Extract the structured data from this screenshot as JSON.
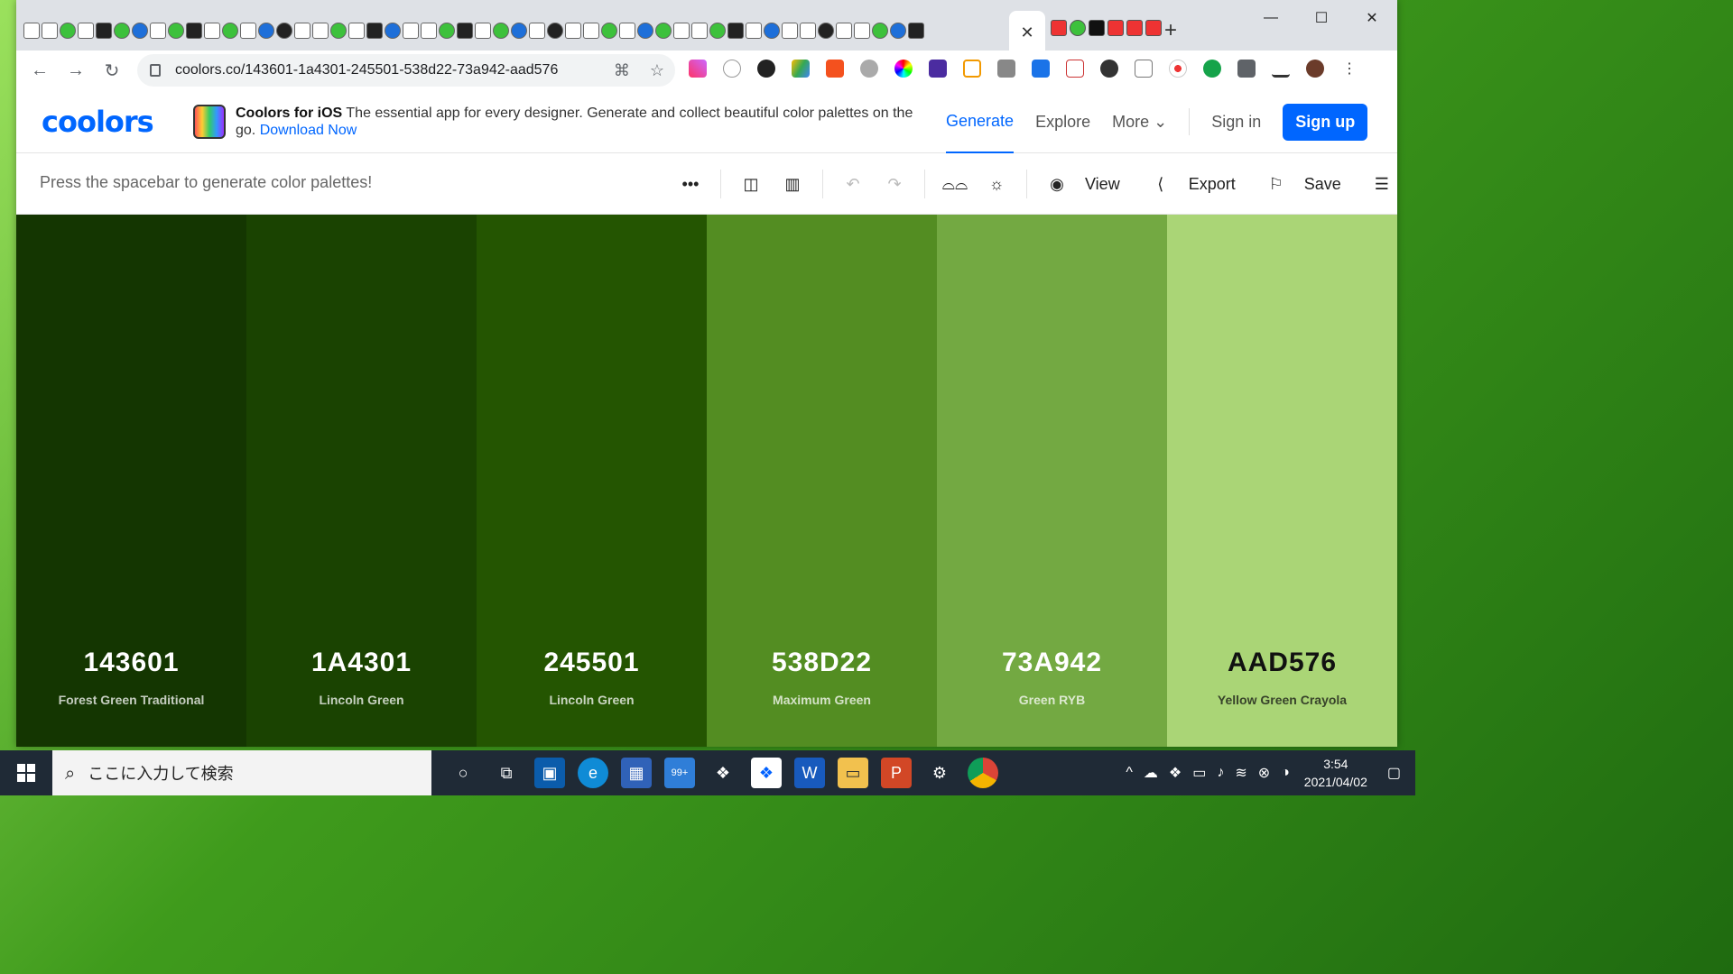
{
  "browser": {
    "url": "coolors.co/143601-1a4301-245501-538d22-73a942-aad576",
    "close_tab": "✕",
    "new_tab": "+",
    "window_controls": {
      "minimize": "—",
      "maximize": "☐",
      "close": "✕"
    }
  },
  "site": {
    "logo": "coolors",
    "promo_title": "Coolors for iOS",
    "promo_text": "The essential app for every designer. Generate and collect beautiful color palettes on the go.",
    "promo_link": "Download Now",
    "nav": {
      "generate": "Generate",
      "explore": "Explore",
      "more": "More",
      "sign_in": "Sign in",
      "sign_up": "Sign up"
    },
    "toolbar": {
      "hint": "Press the spacebar to generate color palettes!",
      "view": "View",
      "export": "Export",
      "save": "Save"
    }
  },
  "palette": [
    {
      "hex": "143601",
      "name": "Forest Green Traditional",
      "color": "#143601",
      "text_color": "#ffffff"
    },
    {
      "hex": "1A4301",
      "name": "Lincoln Green",
      "color": "#1A4301",
      "text_color": "#ffffff"
    },
    {
      "hex": "245501",
      "name": "Lincoln Green",
      "color": "#245501",
      "text_color": "#ffffff"
    },
    {
      "hex": "538D22",
      "name": "Maximum Green",
      "color": "#538D22",
      "text_color": "#ffffff"
    },
    {
      "hex": "73A942",
      "name": "Green RYB",
      "color": "#73A942",
      "text_color": "#ffffff"
    },
    {
      "hex": "AAD576",
      "name": "Yellow Green Crayola",
      "color": "#AAD576",
      "text_color": "#111111"
    }
  ],
  "taskbar": {
    "search_placeholder": "ここに入力して検索",
    "badge": "99+",
    "time": "3:54",
    "date": "2021/04/02"
  },
  "colors": {
    "accent": "#0066ff"
  }
}
